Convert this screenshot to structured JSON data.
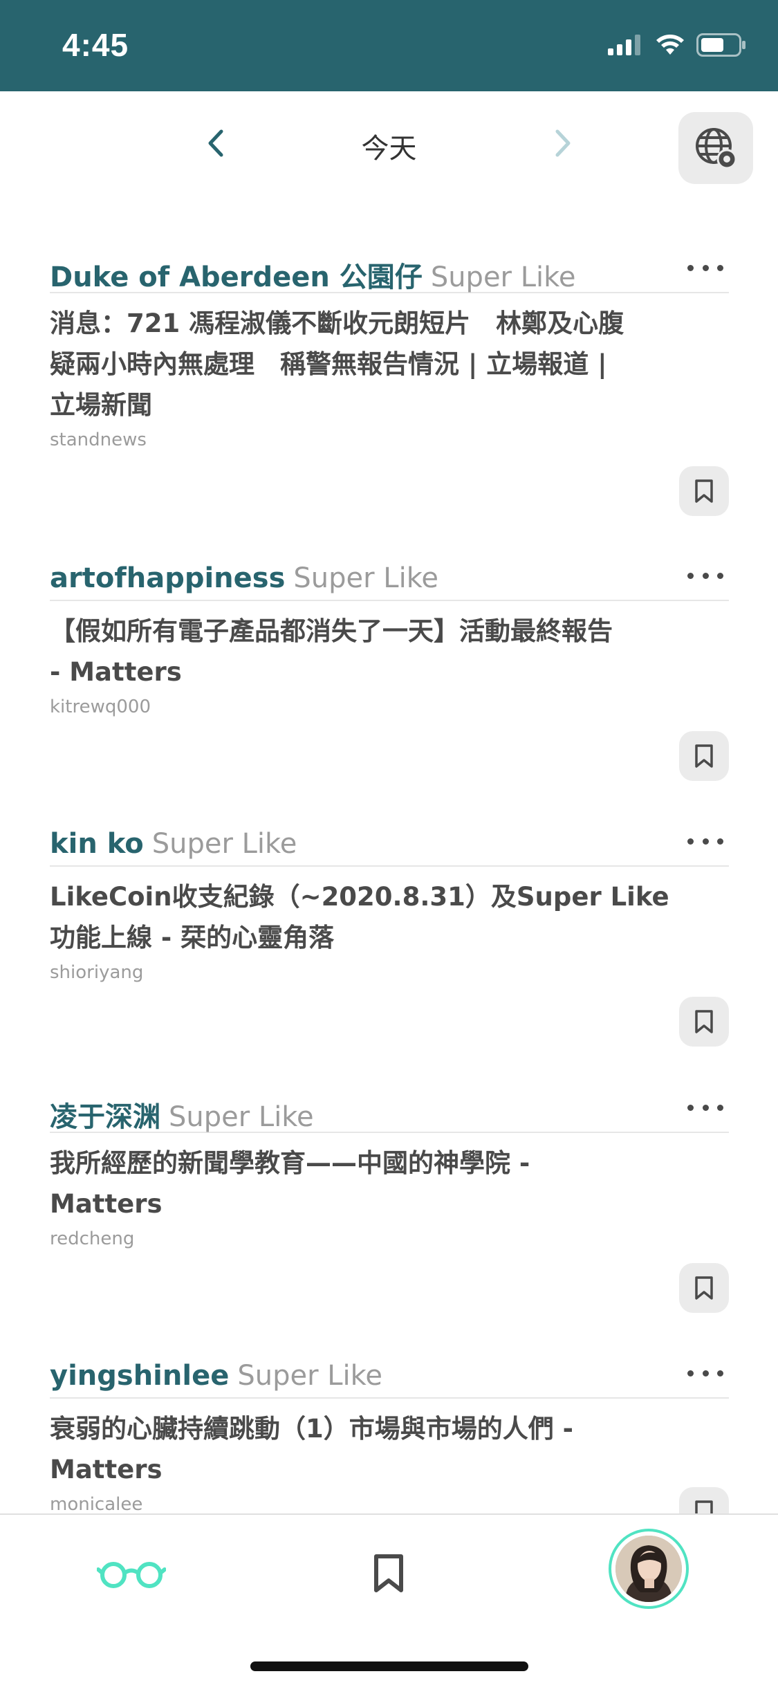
{
  "status_bar": {
    "time": "4:45",
    "icons": [
      "cellular-signal-icon",
      "wifi-icon",
      "battery-icon"
    ]
  },
  "date_nav": {
    "title": "今天",
    "prev_icon": "chevron-left-icon",
    "next_icon": "chevron-right-icon",
    "globe_icon": "globe-settings-icon"
  },
  "feed": {
    "items": [
      {
        "author": "Duke of Aberdeen 公園仔",
        "action": "Super Like",
        "title_lines": [
          "消息：721 馮程淑儀不斷收元朗短片　林鄭及心腹",
          "疑兩小時內無處理　稱警無報告情況 | 立場報道 |",
          "立場新聞"
        ],
        "source": "standnews"
      },
      {
        "author": "artofhappiness",
        "action": "Super Like",
        "title_lines": [
          "【假如所有電子產品都消失了一天】活動最終報告",
          "- Matters"
        ],
        "source": "kitrewq000"
      },
      {
        "author": "kin ko",
        "action": "Super Like",
        "title_lines": [
          "LikeCoin收支紀錄（~2020.8.31）及Super Like",
          "功能上線 - 栞的心靈角落"
        ],
        "source": "shioriyang"
      },
      {
        "author": "凌于深渊",
        "action": "Super Like",
        "title_lines": [
          "我所經歷的新聞學教育——中國的神學院 -",
          "Matters"
        ],
        "source": "redcheng"
      },
      {
        "author": "yingshinlee",
        "action": "Super Like",
        "title_lines": [
          "衰弱的心臟持續跳動（1）市場與市場的人們 -",
          "Matters"
        ],
        "source": "monicalee"
      }
    ]
  },
  "tab_bar": {
    "tabs": [
      "reader-glasses-icon",
      "bookmark-icon",
      "avatar"
    ],
    "active_color": "#50e3c2"
  },
  "colors": {
    "header_bg": "#28646e",
    "accent": "#28646e",
    "muted": "#9b9b9b",
    "text": "#4a4a4a"
  }
}
